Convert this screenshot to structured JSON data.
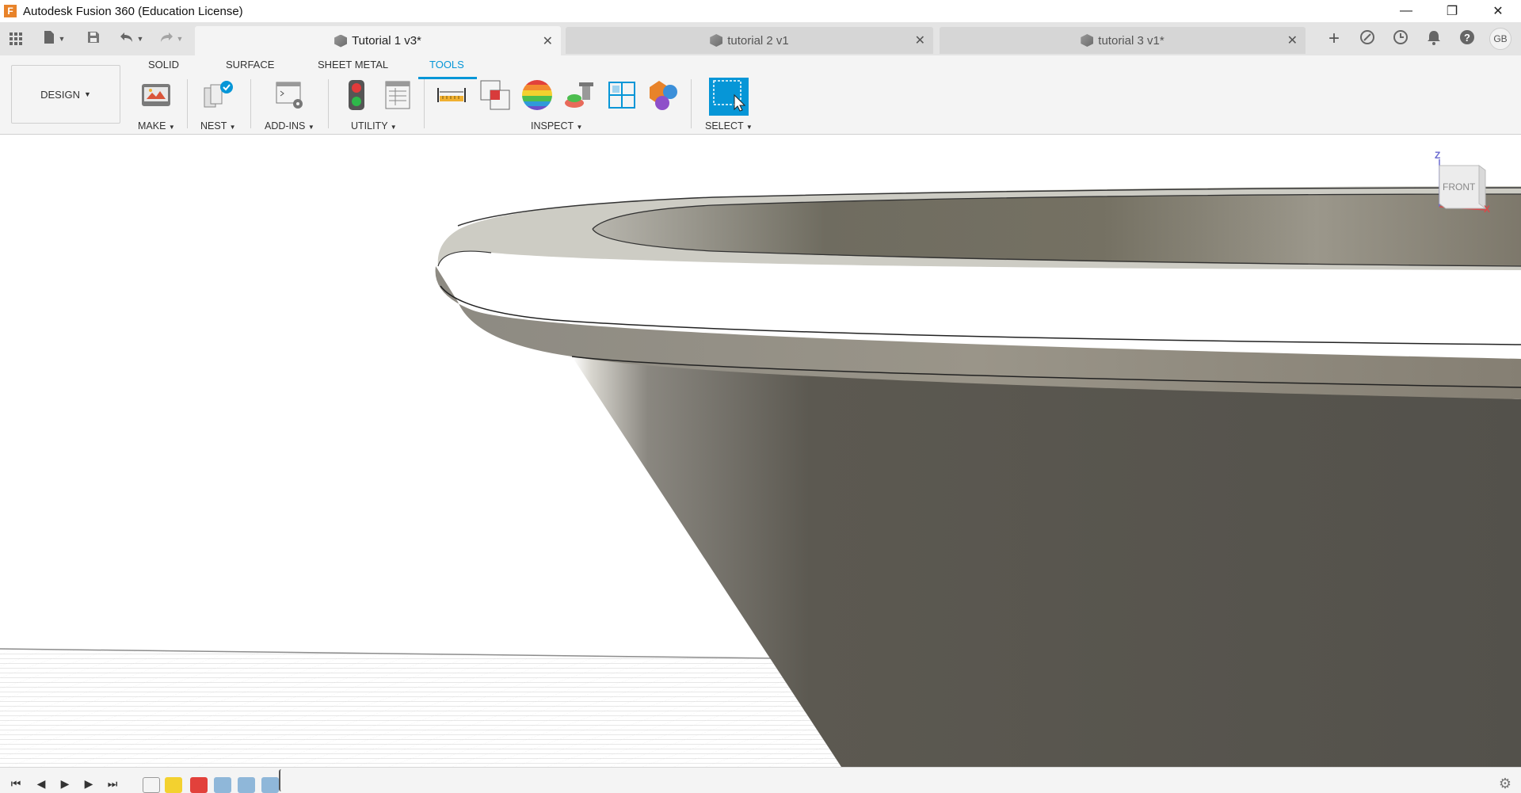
{
  "titlebar": {
    "app_logo": "F",
    "title": "Autodesk Fusion 360 (Education License)",
    "controls": {
      "minimize": "—",
      "restore": "❐",
      "close": "✕"
    }
  },
  "tabs": [
    {
      "label": "Tutorial 1 v3*",
      "active": true
    },
    {
      "label": "tutorial 2 v1",
      "active": false
    },
    {
      "label": "tutorial 3 v1*",
      "active": false
    }
  ],
  "quick_access": {
    "grid_icon": "apps-grid-icon",
    "file_icon": "file-icon",
    "save_icon": "save-icon",
    "undo_icon": "undo-icon",
    "redo_icon": "redo-icon"
  },
  "right_icons": {
    "add": "+",
    "avatar": "GB"
  },
  "ribbon": {
    "design_label": "DESIGN",
    "workspace_tabs": [
      "SOLID",
      "SURFACE",
      "SHEET METAL",
      "TOOLS"
    ],
    "active_tab": "TOOLS",
    "groups": [
      "MAKE",
      "NEST",
      "ADD-INS",
      "UTILITY",
      "INSPECT",
      "SELECT"
    ]
  },
  "viewcube": {
    "face": "FRONT",
    "axis_z": "Z",
    "axis_x": "X"
  },
  "colors": {
    "accent": "#0696d7",
    "brand": "#e8832a",
    "model": "#57544d"
  }
}
